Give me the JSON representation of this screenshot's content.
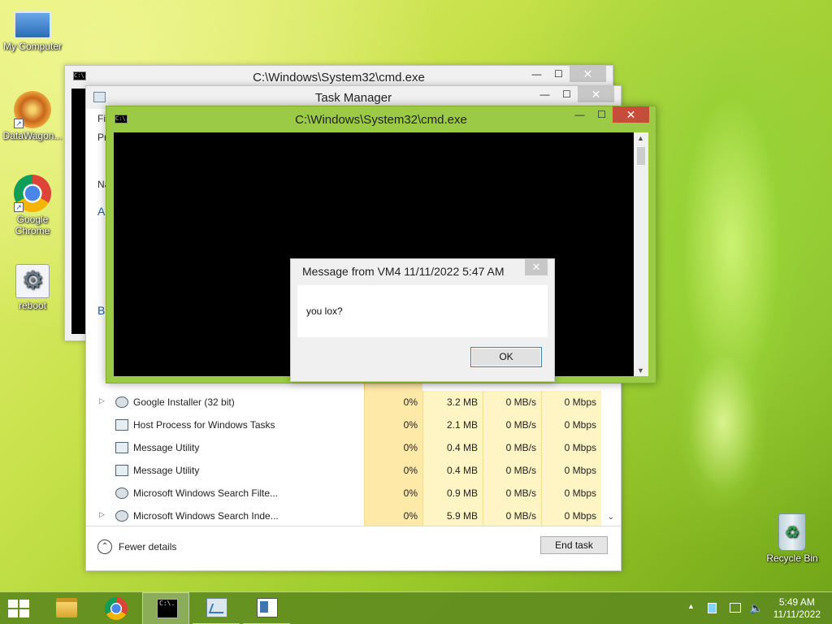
{
  "desktop": {
    "icons": [
      {
        "label": "My Computer"
      },
      {
        "label": "DataWagon..."
      },
      {
        "label": "Google Chrome"
      },
      {
        "label": "reboot"
      },
      {
        "label": "Recycle Bin"
      }
    ]
  },
  "cmd_back": {
    "title": "C:\\Windows\\System32\\cmd.exe",
    "icon_text": "C:\\."
  },
  "task_manager": {
    "title": "Task Manager",
    "menu_fragment": "Fi",
    "tab_fragment": "Pr",
    "col_fragment": "Na",
    "group_fragment_a": "A",
    "group_fragment_b": "B",
    "processes": [
      {
        "name": "Google Installer (32 bit)",
        "cpu": "0%",
        "memory": "3.2 MB",
        "disk": "0 MB/s",
        "network": "0 Mbps",
        "expandable": true,
        "icon": "gear-icon"
      },
      {
        "name": "Host Process for Windows Tasks",
        "cpu": "0%",
        "memory": "2.1 MB",
        "disk": "0 MB/s",
        "network": "0 Mbps",
        "expandable": false,
        "icon": "window-icon"
      },
      {
        "name": "Message Utility",
        "cpu": "0%",
        "memory": "0.4 MB",
        "disk": "0 MB/s",
        "network": "0 Mbps",
        "expandable": false,
        "icon": "window-icon"
      },
      {
        "name": "Message Utility",
        "cpu": "0%",
        "memory": "0.4 MB",
        "disk": "0 MB/s",
        "network": "0 Mbps",
        "expandable": false,
        "icon": "window-icon"
      },
      {
        "name": "Microsoft Windows Search Filte...",
        "cpu": "0%",
        "memory": "0.9 MB",
        "disk": "0 MB/s",
        "network": "0 Mbps",
        "expandable": false,
        "icon": "user-icon"
      },
      {
        "name": "Microsoft Windows Search Inde...",
        "cpu": "0%",
        "memory": "5.9 MB",
        "disk": "0 MB/s",
        "network": "0 Mbps",
        "expandable": true,
        "icon": "user-icon"
      }
    ],
    "fewer_details": "Fewer details",
    "end_task": "End task"
  },
  "cmd_front": {
    "title": "C:\\Windows\\System32\\cmd.exe"
  },
  "message_box": {
    "title": "Message from VM4 11/11/2022 5:47 AM",
    "text": "you lox?",
    "ok_label": "OK"
  },
  "window_buttons": {
    "minimize": "—",
    "maximize": "☐",
    "close": "✕"
  },
  "taskbar": {
    "items": [
      "start",
      "file-explorer",
      "google-chrome",
      "cmd",
      "task-manager",
      "message-utility"
    ],
    "clock": {
      "time": "5:49 AM",
      "date": "11/11/2022"
    },
    "tray_arrow": "▲"
  },
  "colors": {
    "cmd_front_frame": "#9bcb46",
    "close_active": "#c74c3a",
    "cpu_highlight": "#ffe9a8"
  }
}
